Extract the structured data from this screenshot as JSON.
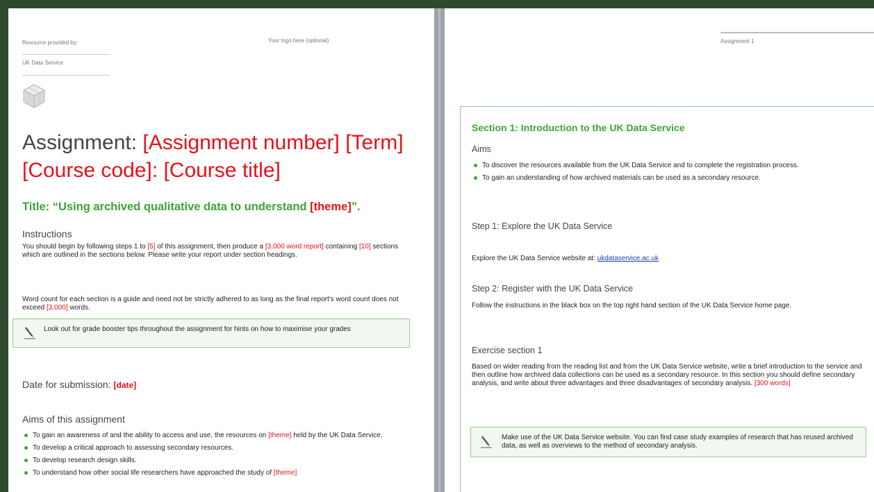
{
  "left": {
    "resource_label": "Resource provided by:",
    "provider": "UK Data Service",
    "logo_note": "Your logo here (optional)",
    "assignment_prefix": "Assignment: ",
    "assignment_fields": "[Assignment number] [Term] [Course code]: [Course title]",
    "title_prefix": "Title: “Using archived qualitative data to understand ",
    "title_theme": "[theme]",
    "title_suffix": "”.",
    "instructions_heading": "Instructions",
    "instr_1": "You should begin by following steps 1 to ",
    "instr_steps": "[5]",
    "instr_2": " of this assignment, then produce a ",
    "instr_words": "[3,000 word report]",
    "instr_3": " containing ",
    "instr_sections": "[10]",
    "instr_4": " sections which are outlined in the sections below. Please write your report under section headings.",
    "wc_1": "Word count for each section is a guide and need not be strictly adhered to as long as the final report's word count does not exceed ",
    "wc_limit": "[3,000]",
    "wc_2": " words.",
    "tip": "Look out for grade booster tips throughout the assignment for hints on how to maximise your grades",
    "date_label": "Date for submission: ",
    "date_value": "[date]",
    "aims_heading": "Aims of this assignment",
    "aim1_a": "To gain an awareness of and the ability to access and use, the resources on ",
    "aim1_theme": "[theme]",
    "aim1_b": " held by the UK Data Service.",
    "aim2": "To develop a critical approach to assessing secondary resources.",
    "aim3": "To develop research design skills.",
    "aim4_a": "To understand how other social life researchers have approached the study of ",
    "aim4_theme": "[theme]"
  },
  "right": {
    "header_label": "Assignment 1",
    "section_heading": "Section 1: Introduction to the UK Data Service",
    "aims_heading": "Aims",
    "aim1": "To discover the resources available from the UK Data Service and to complete the registration process.",
    "aim2": "To gain an understanding of how archived materials can be used as a secondary resource.",
    "step1_heading": "Step 1: Explore the UK Data Service",
    "step1_text": "Explore the UK Data Service website at: ",
    "step1_link": "ukdataservice.ac.uk",
    "step2_heading": "Step 2: Register with the UK Data Service",
    "step2_text": "Follow the instructions in the black box on the top right hand section of the UK Data Service home page.",
    "exercise_heading": "Exercise section 1",
    "exercise_text": "Based on wider reading from the reading list and from the UK Data Service website, write a brief introduction to the service and then outline how archived data collections can be used as a secondary resource. In this section you should define secondary analysis, and write about three advantages and three disadvantages of secondary analysis. ",
    "exercise_words": "[300 words]",
    "tip": "Make use of the UK Data Service website. You can find case study examples of research that has reused archived data, as well as overviews to the method of secondary analysis."
  },
  "colors": {
    "accent_red": "#e8101a",
    "accent_green": "#3aa535",
    "frame": "#2e4a2e"
  },
  "icons": {
    "logo": "cube-logo-icon",
    "tip": "pencil-icon",
    "bullet": "green-bullet-icon"
  }
}
